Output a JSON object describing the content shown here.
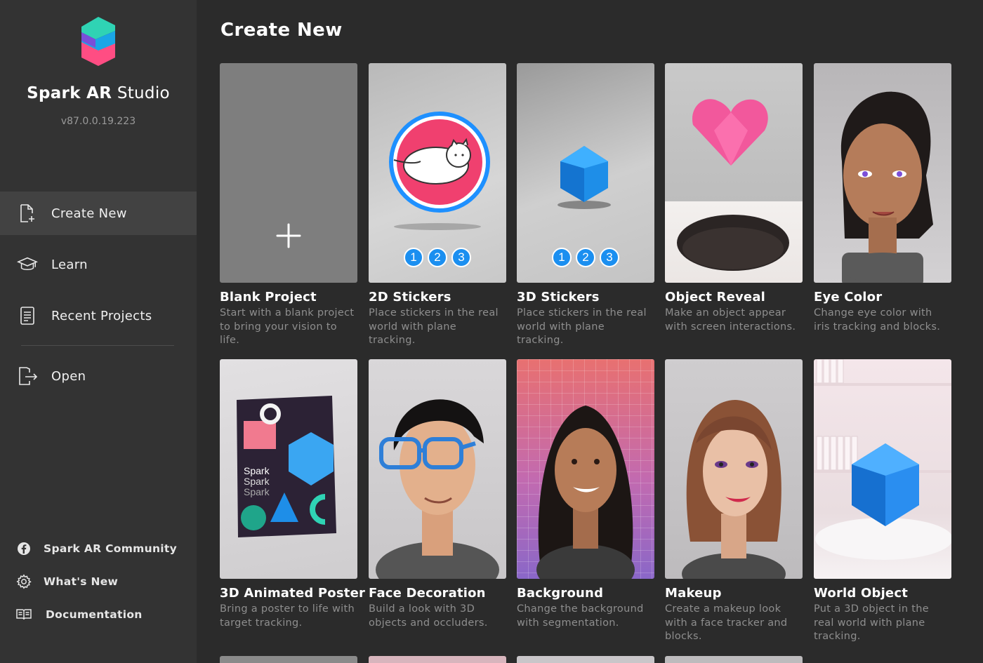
{
  "app": {
    "name_bold": "Spark AR",
    "name_light": " Studio",
    "version": "v87.0.0.19.223"
  },
  "nav": {
    "items": [
      {
        "label": "Create New",
        "icon": "new-file-icon",
        "active": true
      },
      {
        "label": "Learn",
        "icon": "graduation-cap-icon"
      },
      {
        "label": "Recent Projects",
        "icon": "document-list-icon"
      },
      {
        "label": "Open",
        "icon": "open-file-icon"
      }
    ],
    "footer": [
      {
        "label": "Spark AR Community",
        "icon": "facebook-icon"
      },
      {
        "label": "What's New",
        "icon": "gear-icon"
      },
      {
        "label": "Documentation",
        "icon": "book-icon"
      }
    ]
  },
  "main": {
    "title": "Create New",
    "templates": [
      {
        "title": "Blank Project",
        "desc": "Start with a blank project to bring your vision to life."
      },
      {
        "title": "2D Stickers",
        "desc": "Place stickers in the real world with plane tracking."
      },
      {
        "title": "3D Stickers",
        "desc": "Place stickers in the real world with plane tracking."
      },
      {
        "title": "Object Reveal",
        "desc": "Make an object appear with screen interactions."
      },
      {
        "title": "Eye Color",
        "desc": "Change eye color with iris tracking and blocks."
      },
      {
        "title": "3D Animated Poster",
        "desc": "Bring a poster to life with target tracking."
      },
      {
        "title": "Face Decoration",
        "desc": "Build a look with 3D objects and occluders."
      },
      {
        "title": "Background",
        "desc": "Change the background with segmentation."
      },
      {
        "title": "Makeup",
        "desc": "Create a makeup look with a face tracker and blocks."
      },
      {
        "title": "World Object",
        "desc": "Put a 3D object in the real world with plane tracking."
      }
    ],
    "sticker_steps": [
      "1",
      "2",
      "3"
    ],
    "poster_text": [
      "Spark",
      "Spark",
      "Spark"
    ]
  },
  "colors": {
    "sidebar": "#333333",
    "background": "#2b2b2b",
    "active_nav": "#424242",
    "accent_blue": "#1b8ff0",
    "muted_text": "#8e8e8e"
  }
}
